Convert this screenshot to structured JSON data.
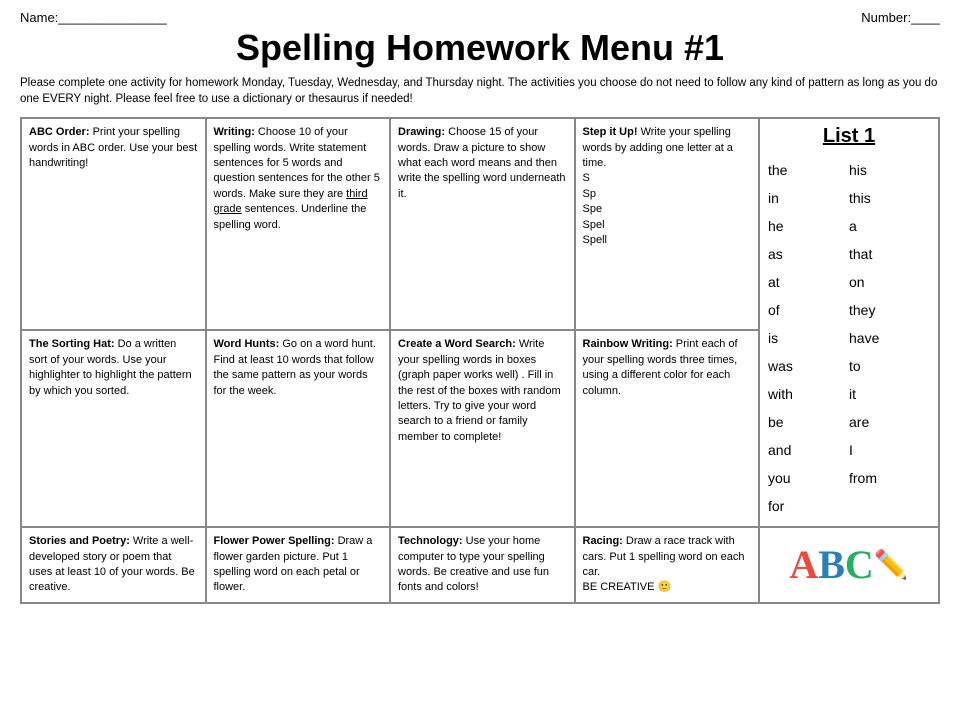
{
  "header": {
    "name_label": "Name:_______________",
    "number_label": "Number:____",
    "title": "Spelling Homework Menu #1",
    "instructions": "Please complete one activity for homework Monday, Tuesday, Wednesday, and Thursday night.   The activities you choose do not need to follow any kind of pattern as long as you do one EVERY night.  Please feel free to use a dictionary or thesaurus if needed!"
  },
  "cells": [
    {
      "id": "abc-order",
      "row": 1,
      "col": 1,
      "title": "ABC Order:",
      "body": "Print your spelling words in ABC order.  Use your best handwriting!"
    },
    {
      "id": "writing",
      "row": 1,
      "col": 2,
      "title": "Writing:",
      "body": "Choose 10 of your spelling words.  Write statement sentences for 5 words and question sentences for the other 5 words.  Make sure they are third grade sentences.  Underline the spelling word."
    },
    {
      "id": "drawing",
      "row": 1,
      "col": 3,
      "title": "Drawing:",
      "body": "Choose 15 of your words.  Draw a picture to show what each word means and then write the spelling word underneath it."
    },
    {
      "id": "step-it-up",
      "row": 1,
      "col": 4,
      "title": "Step it Up!",
      "body": "Write your spelling words by adding one letter at a time.\nS\nSp\nSpe\nSpel\nSpell"
    },
    {
      "id": "sorting-hat",
      "row": 2,
      "col": 1,
      "title": "The Sorting Hat:",
      "body": "Do a written sort of your words.  Use your highlighter to highlight the pattern by which you sorted."
    },
    {
      "id": "word-hunts",
      "row": 2,
      "col": 2,
      "title": "Word Hunts:",
      "body": "Go on a word hunt.  Find at least 10 words that follow the same pattern as your words for the week."
    },
    {
      "id": "word-search",
      "row": 2,
      "col": 3,
      "title": "Create a Word Search:",
      "body": "Write your spelling words in boxes (graph paper works well) .  Fill in the rest of the boxes with random letters.  Try to give your word search to a friend or family member to complete!"
    },
    {
      "id": "rainbow-writing",
      "row": 2,
      "col": 4,
      "title": "Rainbow Writing:",
      "body": "Print each of your spelling words three times, using a different color for each column."
    },
    {
      "id": "stories-poetry",
      "row": 3,
      "col": 1,
      "title": "Stories and Poetry:",
      "body": "Write a well-developed story or poem that uses at least 10 of your words.  Be creative."
    },
    {
      "id": "flower-power",
      "row": 3,
      "col": 2,
      "title": "Flower Power Spelling:",
      "body": "Draw a flower garden picture.  Put 1 spelling word on each petal or flower."
    },
    {
      "id": "technology",
      "row": 3,
      "col": 3,
      "title": "Technology:",
      "body": "Use your home computer to type your spelling words.  Be creative and use fun fonts and colors!"
    },
    {
      "id": "racing",
      "row": 3,
      "col": 4,
      "title": "Racing:",
      "body": "Draw a race track with cars.  Put 1 spelling word on each car.\nBE CREATIVE 😊"
    }
  ],
  "list": {
    "title": "List 1",
    "words_left": [
      "the",
      "in",
      "he",
      "as",
      "at",
      "of",
      "is",
      "was",
      "with",
      "be",
      "and",
      "you",
      "for"
    ],
    "words_right": [
      "his",
      "this",
      "a",
      "that",
      "on",
      "they",
      "have",
      "to",
      "it",
      "are",
      "I",
      "from"
    ]
  },
  "abc_display": {
    "a": "A",
    "b": "B",
    "c": "C"
  }
}
